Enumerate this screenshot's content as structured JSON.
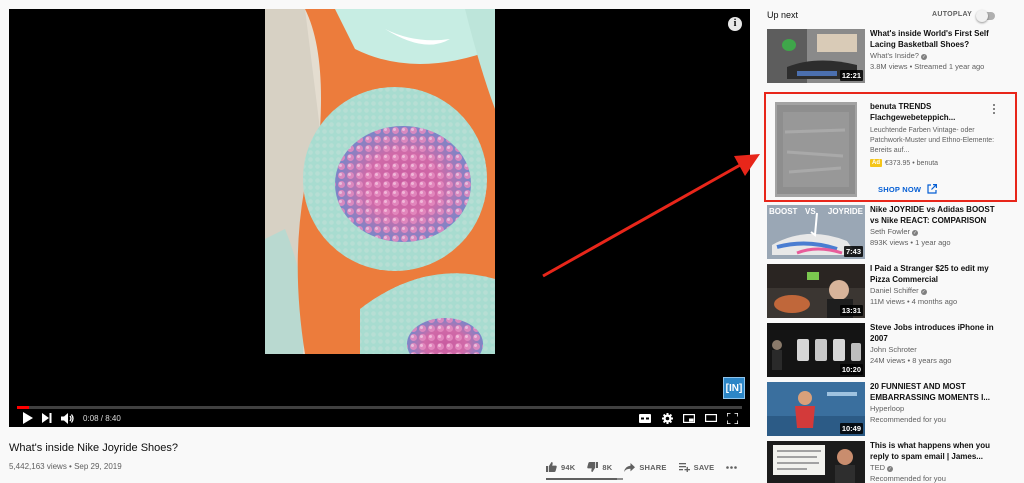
{
  "player": {
    "current_time": "0:08",
    "duration": "8:40",
    "time_separator": " / ",
    "progress_fraction": 0.016,
    "branding_label": "[IN]",
    "info_glyph": "i",
    "icons": [
      "play-icon",
      "next-icon",
      "volume-icon",
      "captions-icon",
      "settings-icon",
      "miniplayer-icon",
      "theater-icon",
      "fullscreen-icon",
      "info-icon"
    ]
  },
  "video": {
    "title": "What's inside Nike Joyride Shoes?",
    "views": "5,442,163 views",
    "date_separator": " • ",
    "date": "Sep 29, 2019",
    "likes": "94K",
    "dislikes": "8K",
    "share_label": "SHARE",
    "save_label": "SAVE",
    "like_fraction": 0.92
  },
  "sidebar": {
    "up_next_label": "Up next",
    "autoplay_label": "AUTOPLAY",
    "autoplay_on": false,
    "videos": [
      {
        "title": "What's inside World's First Self Lacing Basketball Shoes?",
        "channel": "What's Inside?",
        "verified": true,
        "stats": "3.8M views • Streamed 1 year ago",
        "duration": "12:21"
      },
      {
        "title": "Nike JOYRIDE vs Adidas BOOST vs Nike REACT: COMPARISON",
        "channel": "Seth Fowler",
        "verified": true,
        "stats": "893K views • 1 year ago",
        "duration": "7:43",
        "thumb_text_left": "BOOST",
        "thumb_text_right": "JOYRIDE"
      },
      {
        "title": "I Paid a Stranger $25 to edit my Pizza Commercial",
        "channel": "Daniel Schiffer",
        "verified": true,
        "stats": "11M views • 4 months ago",
        "duration": "13:31"
      },
      {
        "title": "Steve Jobs introduces iPhone in 2007",
        "channel": "John Schroter",
        "verified": false,
        "stats": "24M views • 8 years ago",
        "duration": "10:20"
      },
      {
        "title": "20 FUNNIEST AND MOST EMBARRASSING MOMENTS I...",
        "channel": "Hyperloop",
        "verified": false,
        "stats": "Recommended for you",
        "duration": "10:49"
      },
      {
        "title": "This is what happens when you reply to spam email | James...",
        "channel": "TED",
        "verified": true,
        "stats": "Recommended for you",
        "duration": ""
      }
    ],
    "ad": {
      "title": "benuta TRENDS Flachgewebeteppich...",
      "description": "Leuchtende Farben Vintage- oder Patchwork-Muster und Ethno-Elemente: Bereits auf...",
      "badge": "Ad",
      "price": "€373.95",
      "separator": " • ",
      "advertiser": "benuta",
      "cta": "SHOP NOW"
    }
  },
  "colors": {
    "accent": "#ff0000",
    "highlight_box": "#e8261a",
    "link_blue": "#065fd4",
    "ad_badge": "#f5c518"
  }
}
